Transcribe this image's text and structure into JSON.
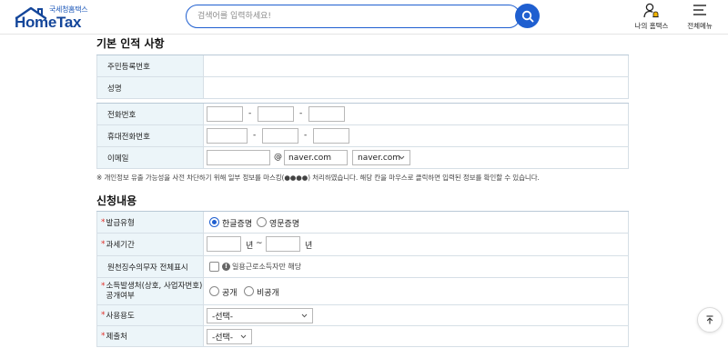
{
  "header": {
    "logo_sub": "국세청홈택스",
    "logo_main": "HomeTax",
    "search_placeholder": "검색어를 입력하세요!",
    "my_hometax_label": "나의 홈택스",
    "all_menu_label": "전체메뉴"
  },
  "basic": {
    "title": "기본 인적 사항",
    "rows": {
      "rrn": "주민등록번호",
      "name": "성명",
      "phone": "전화번호",
      "mobile": "휴대전화번호",
      "email": "이메일"
    },
    "dash": "-",
    "at": "@",
    "email_domain_value": "naver.com",
    "email_domain_select": "naver.com",
    "note": "※ 개인정보 유출 가능성을 사전 차단하기 위해 일부 정보를 마스킹(●●●●) 처리하였습니다. 해당 칸을 마우스로 클릭하면 입력된 정보를 확인할 수 있습니다."
  },
  "apply": {
    "title": "신청내용",
    "required_mark": "*",
    "issue_type": {
      "label": "발급유형",
      "options": [
        "한글증명",
        "영문증명"
      ],
      "selected": "한글증명"
    },
    "tax_period": {
      "label": "과세기간",
      "year_unit": "년",
      "tilde": "~"
    },
    "withholding": {
      "label": "원천징수의무자 전체표시",
      "hint": "일용근로소득자만 해당",
      "info_glyph": "!"
    },
    "disclosure": {
      "label_line1": "소득발생처(상호, 사업자번호)",
      "label_line2": "공개여부",
      "options": [
        "공개",
        "비공개"
      ]
    },
    "purpose": {
      "label": "사용용도",
      "value": "-선택-"
    },
    "submit_to": {
      "label": "제출처",
      "value": "-선택-"
    }
  },
  "colors": {
    "accent": "#1f5fd0",
    "logo": "#14469a",
    "th_bg": "#ecf5f9",
    "required": "#e0302a"
  },
  "icons": [
    "search-icon",
    "user-bell-icon",
    "hamburger-menu-icon",
    "chevron-down-icon",
    "info-icon",
    "scroll-top-icon"
  ]
}
